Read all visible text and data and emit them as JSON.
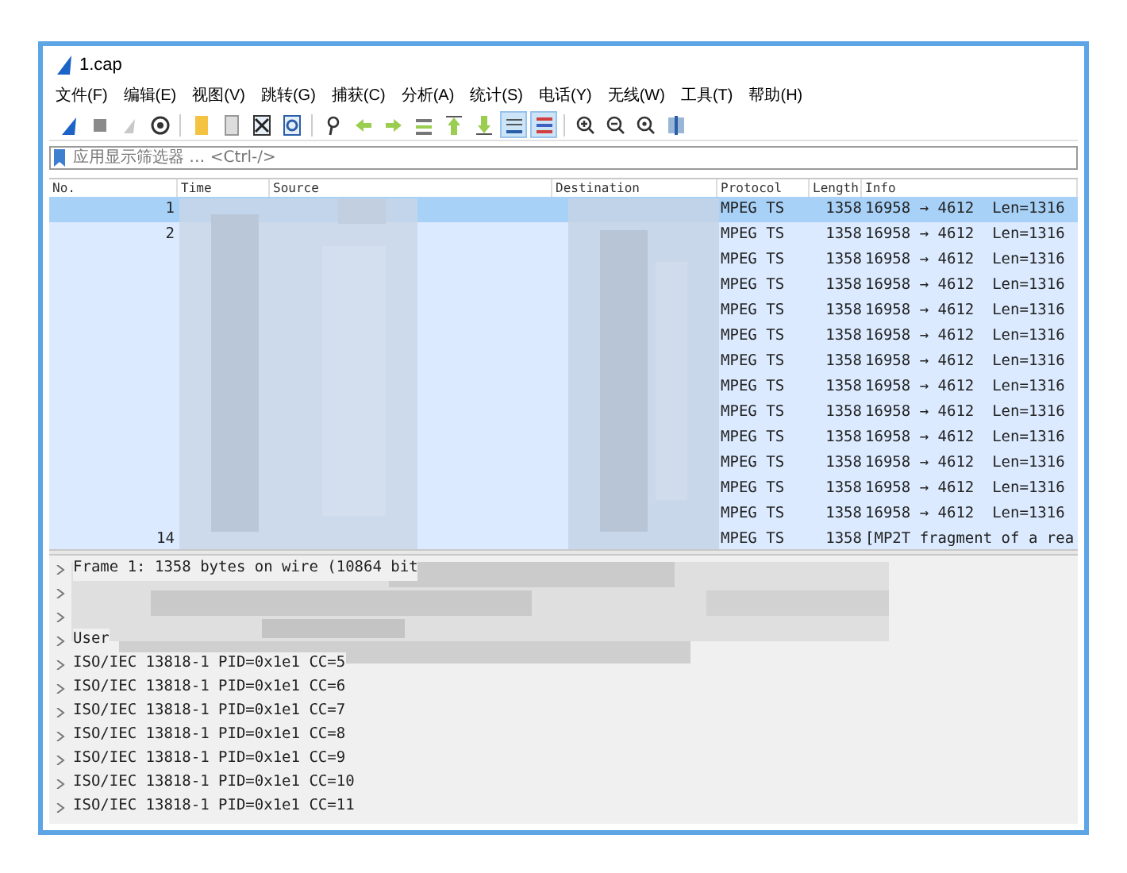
{
  "window": {
    "title": "1.cap"
  },
  "menu": [
    "文件(F)",
    "编辑(E)",
    "视图(V)",
    "跳转(G)",
    "捕获(C)",
    "分析(A)",
    "统计(S)",
    "电话(Y)",
    "无线(W)",
    "工具(T)",
    "帮助(H)"
  ],
  "toolbar": [
    {
      "pressed": false
    },
    {
      "pressed": false
    },
    {
      "pressed": false
    },
    {
      "pressed": false
    },
    {
      "pressed": false
    },
    {
      "pressed": false
    },
    {
      "pressed": false
    },
    {
      "pressed": false
    },
    {
      "pressed": false
    },
    {
      "pressed": false
    },
    {
      "pressed": false
    },
    {
      "pressed": false
    },
    {
      "pressed": false
    },
    {
      "pressed": false
    },
    {
      "pressed": true
    },
    {
      "pressed": true
    },
    {
      "pressed": false
    },
    {
      "pressed": false
    },
    {
      "pressed": false
    },
    {
      "pressed": false
    }
  ],
  "filter": {
    "placeholder": "应用显示筛选器 … <Ctrl-/>"
  },
  "columns": [
    "No.",
    "Time",
    "Source",
    "Destination",
    "Protocol",
    "Length",
    "Info"
  ],
  "packets": [
    {
      "no": "1",
      "protocol": "MPEG TS",
      "length": "1358",
      "info": "16958 → 4612  Len=1316",
      "selected": true
    },
    {
      "no": "2",
      "protocol": "MPEG TS",
      "length": "1358",
      "info": "16958 → 4612  Len=1316",
      "selected": false
    },
    {
      "protocol": "MPEG TS",
      "length": "1358",
      "info": "16958 → 4612  Len=1316",
      "selected": false
    },
    {
      "protocol": "MPEG TS",
      "length": "1358",
      "info": "16958 → 4612  Len=1316",
      "selected": false
    },
    {
      "protocol": "MPEG TS",
      "length": "1358",
      "info": "16958 → 4612  Len=1316",
      "selected": false
    },
    {
      "protocol": "MPEG TS",
      "length": "1358",
      "info": "16958 → 4612  Len=1316",
      "selected": false
    },
    {
      "protocol": "MPEG TS",
      "length": "1358",
      "info": "16958 → 4612  Len=1316",
      "selected": false
    },
    {
      "protocol": "MPEG TS",
      "length": "1358",
      "info": "16958 → 4612  Len=1316",
      "selected": false
    },
    {
      "protocol": "MPEG TS",
      "length": "1358",
      "info": "16958 → 4612  Len=1316",
      "selected": false
    },
    {
      "protocol": "MPEG TS",
      "length": "1358",
      "info": "16958 → 4612  Len=1316",
      "selected": false
    },
    {
      "protocol": "MPEG TS",
      "length": "1358",
      "info": "16958 → 4612  Len=1316",
      "selected": false
    },
    {
      "protocol": "MPEG TS",
      "length": "1358",
      "info": "16958 → 4612  Len=1316",
      "selected": false
    },
    {
      "protocol": "MPEG TS",
      "length": "1358",
      "info": "16958 → 4612  Len=1316",
      "selected": false
    },
    {
      "no": "14",
      "protocol": "MPEG TS",
      "length": "1358",
      "info": "[MP2T fragment of a rea",
      "selected": false
    }
  ],
  "details": [
    {
      "text": "Frame 1: 1358 bytes on wire (10864 bit",
      "expanded": false
    },
    {
      "expanded": false
    },
    {
      "expanded": false
    },
    {
      "text": "User",
      "expanded": false
    },
    {
      "text": "ISO/IEC 13818-1 PID=0x1e1 CC=5",
      "expanded": false
    },
    {
      "text": "ISO/IEC 13818-1 PID=0x1e1 CC=6",
      "expanded": false
    },
    {
      "text": "ISO/IEC 13818-1 PID=0x1e1 CC=7",
      "expanded": false
    },
    {
      "text": "ISO/IEC 13818-1 PID=0x1e1 CC=8",
      "expanded": false
    },
    {
      "text": "ISO/IEC 13818-1 PID=0x1e1 CC=9",
      "expanded": false
    },
    {
      "text": "ISO/IEC 13818-1 PID=0x1e1 CC=10",
      "expanded": false
    },
    {
      "text": "ISO/IEC 13818-1 PID=0x1e1 CC=11",
      "expanded": false
    }
  ]
}
